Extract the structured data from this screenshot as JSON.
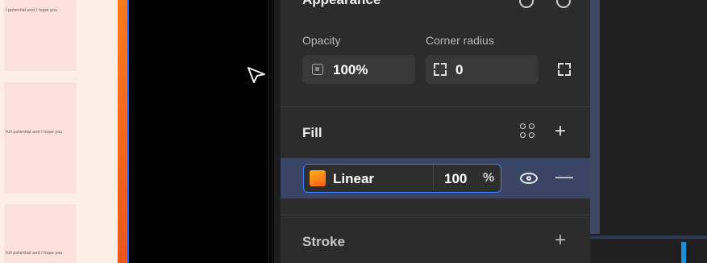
{
  "canvas": {
    "card_texts": [
      "l potential and I hope you",
      "full potential and I hope you",
      "full potential and I hope you"
    ]
  },
  "appearance": {
    "title": "Appearance",
    "opacity_label": "Opacity",
    "opacity_value": "100%",
    "corner_radius_label": "Corner radius",
    "corner_radius_value": "0"
  },
  "fill": {
    "title": "Fill",
    "type": "Linear",
    "opacity": "100",
    "percent_symbol": "%",
    "colors": {
      "gradient_start": "#ffb21e",
      "gradient_end": "#ff5a12"
    }
  },
  "stroke": {
    "title": "Stroke"
  },
  "icons": {
    "add": "+",
    "remove": "—"
  },
  "colors": {
    "panel_bg": "#2c2c2c",
    "selected_row": "#3a4566",
    "focus_border": "#3d7bff",
    "accent_orange": "#ff7a1a"
  }
}
